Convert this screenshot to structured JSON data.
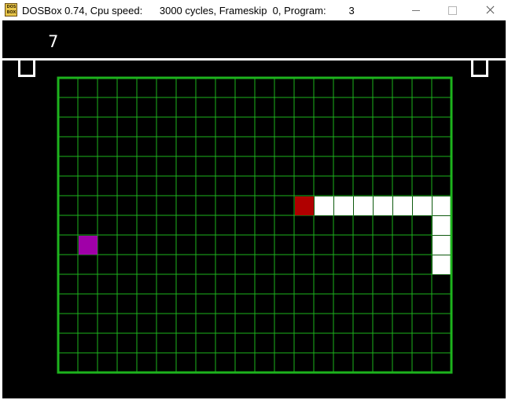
{
  "window": {
    "title": "DOSBox 0.74, Cpu speed:      3000 cycles, Frameskip  0, Program:        3",
    "icon_top": "DOS",
    "icon_bottom": "BOX"
  },
  "game": {
    "score": "7",
    "grid": {
      "columns": 20,
      "rows": 15,
      "line_color": "#1db31d"
    },
    "snake": {
      "color": "#ffffff",
      "head_color": "#b00000",
      "cells": [
        [
          12,
          6
        ],
        [
          13,
          6
        ],
        [
          14,
          6
        ],
        [
          15,
          6
        ],
        [
          16,
          6
        ],
        [
          17,
          6
        ],
        [
          18,
          6
        ],
        [
          19,
          6
        ],
        [
          19,
          7
        ],
        [
          19,
          8
        ],
        [
          19,
          9
        ]
      ]
    },
    "food": {
      "color": "#a000a8",
      "cell": [
        1,
        8
      ]
    }
  }
}
